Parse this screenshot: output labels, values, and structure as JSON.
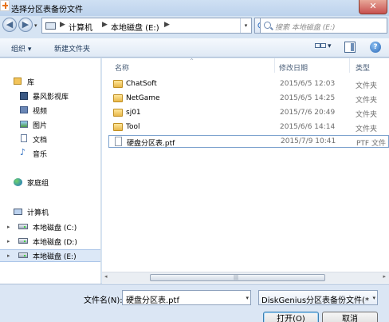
{
  "window": {
    "title": "选择分区表备份文件",
    "close_glyph": "✕"
  },
  "navbar": {
    "back_glyph": "◀",
    "forward_glyph": "▶",
    "dropdown_glyph": "▾",
    "breadcrumb": [
      "计算机",
      "本地磁盘 (E:)"
    ],
    "crumb_separator": "▶",
    "refresh_glyph": "⟳",
    "search_placeholder": "搜索 本地磁盘 (E:)"
  },
  "toolbar": {
    "organize_label": "组织 ▾",
    "new_folder_label": "新建文件夹",
    "view_dropdown": "▾",
    "help_glyph": "?"
  },
  "nav_pane": {
    "libraries": {
      "label": "库",
      "items": [
        "暴风影视库",
        "视频",
        "图片",
        "文档",
        "音乐"
      ]
    },
    "homegroup": "家庭组",
    "computer": {
      "label": "计算机",
      "drives": [
        "本地磁盘 (C:)",
        "本地磁盘 (D:)",
        "本地磁盘 (E:)"
      ],
      "selected": "本地磁盘 (E:)"
    },
    "expand_glyph": "▸"
  },
  "file_list": {
    "columns": {
      "name": "名称",
      "date": "修改日期",
      "type": "类型"
    },
    "sort_glyph": "^",
    "rows": [
      {
        "name": "ChatSoft",
        "date": "2015/6/5 12:03",
        "type": "文件夹",
        "kind": "folder"
      },
      {
        "name": "NetGame",
        "date": "2015/6/5 14:25",
        "type": "文件夹",
        "kind": "folder"
      },
      {
        "name": "sj01",
        "date": "2015/7/6 20:49",
        "type": "文件夹",
        "kind": "folder"
      },
      {
        "name": "Tool",
        "date": "2015/6/6 14:14",
        "type": "文件夹",
        "kind": "folder"
      },
      {
        "name": "硬盘分区表.ptf",
        "date": "2015/7/9 10:41",
        "type": "PTF 文件",
        "kind": "file"
      }
    ]
  },
  "scrollbar": {
    "left_glyph": "◂",
    "right_glyph": "▸",
    "grip_glyph": "|||"
  },
  "footer": {
    "filename_label": "文件名(N):",
    "filename_value": "硬盘分区表.ptf",
    "filetype_value": "DiskGenius分区表备份文件(*",
    "open_button": "打开(O)",
    "cancel_button": "取消"
  }
}
